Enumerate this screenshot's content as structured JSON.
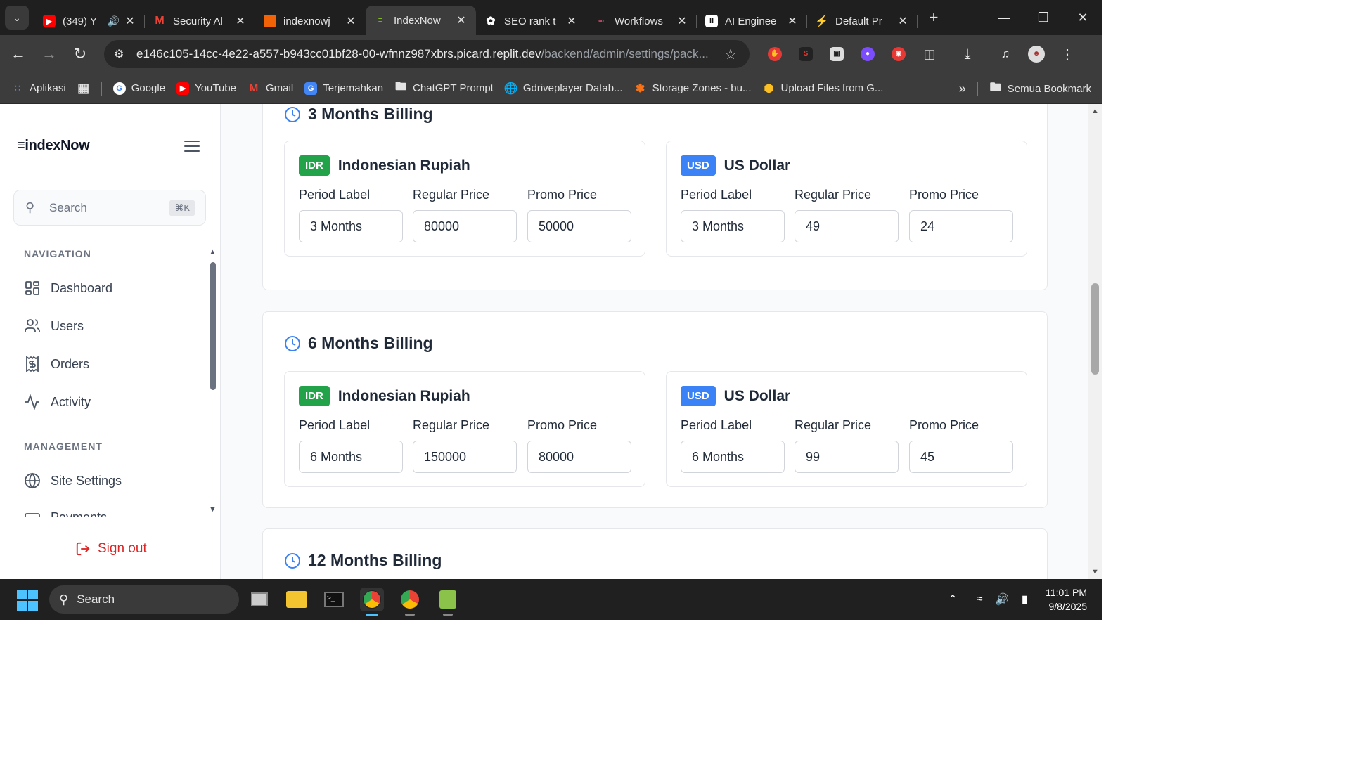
{
  "browser": {
    "tabs": [
      {
        "title": "(349) Y",
        "icon": "youtube-icon",
        "color": "#ff0000"
      },
      {
        "title": "Security Al",
        "icon": "gmail-icon",
        "color": "#ea4335"
      },
      {
        "title": "indexnowj",
        "icon": "replit-icon",
        "color": "#f26207"
      },
      {
        "title": "IndexNow",
        "icon": "indexnow-icon",
        "color": "#84cc16"
      },
      {
        "title": "SEO rank t",
        "icon": "openai-icon",
        "color": "#ffffff"
      },
      {
        "title": "Workflows",
        "icon": "n8n-icon",
        "color": "#ea4b71"
      },
      {
        "title": "AI Enginee",
        "icon": "app-icon",
        "color": "#ffffff"
      },
      {
        "title": "Default Pr",
        "icon": "supabase-icon",
        "color": "#3ecf8e"
      }
    ],
    "url_host": "e146c105-14cc-4e22-a557-b943cc01bf28-00-wfnnz987xbrs.picard.replit.dev",
    "url_path": "/backend/admin/settings/pack...",
    "bookmarks": [
      {
        "label": "Aplikasi",
        "icon": "apps-grid-icon"
      },
      {
        "label": "Google",
        "icon": "google-icon"
      },
      {
        "label": "YouTube",
        "icon": "youtube-icon"
      },
      {
        "label": "Gmail",
        "icon": "gmail-icon"
      },
      {
        "label": "Terjemahkan",
        "icon": "translate-icon"
      },
      {
        "label": "ChatGPT Prompt",
        "icon": "folder-icon"
      },
      {
        "label": "Gdriveplayer Datab...",
        "icon": "globe-icon"
      },
      {
        "label": "Storage Zones - bu...",
        "icon": "bunny-icon"
      },
      {
        "label": "Upload Files from G...",
        "icon": "box-icon"
      }
    ],
    "all_bookmarks": "Semua Bookmark"
  },
  "sidebar": {
    "logo": "≡indexNow",
    "search_placeholder": "Search",
    "search_shortcut": "⌘K",
    "nav_heading": "NAVIGATION",
    "nav_items": [
      "Dashboard",
      "Users",
      "Orders",
      "Activity"
    ],
    "mgmt_heading": "MANAGEMENT",
    "mgmt_items": [
      "Site Settings",
      "Payments"
    ],
    "sign_out": "Sign out"
  },
  "pricing": {
    "field_labels": {
      "period": "Period Label",
      "regular": "Regular Price",
      "promo": "Promo Price"
    },
    "currencies": {
      "idr": {
        "code": "IDR",
        "name": "Indonesian Rupiah",
        "color": "#22a34a"
      },
      "usd": {
        "code": "USD",
        "name": "US Dollar",
        "color": "#3b82f6"
      }
    },
    "blocks": [
      {
        "title": "3 Months Billing",
        "idr": {
          "period": "3 Months",
          "regular": "80000",
          "promo": "50000"
        },
        "usd": {
          "period": "3 Months",
          "regular": "49",
          "promo": "24"
        }
      },
      {
        "title": "6 Months Billing",
        "idr": {
          "period": "6 Months",
          "regular": "150000",
          "promo": "80000"
        },
        "usd": {
          "period": "6 Months",
          "regular": "99",
          "promo": "45"
        }
      },
      {
        "title": "12 Months Billing"
      }
    ]
  },
  "taskbar": {
    "search_placeholder": "Search",
    "time": "11:01 PM",
    "date": "9/8/2025"
  }
}
